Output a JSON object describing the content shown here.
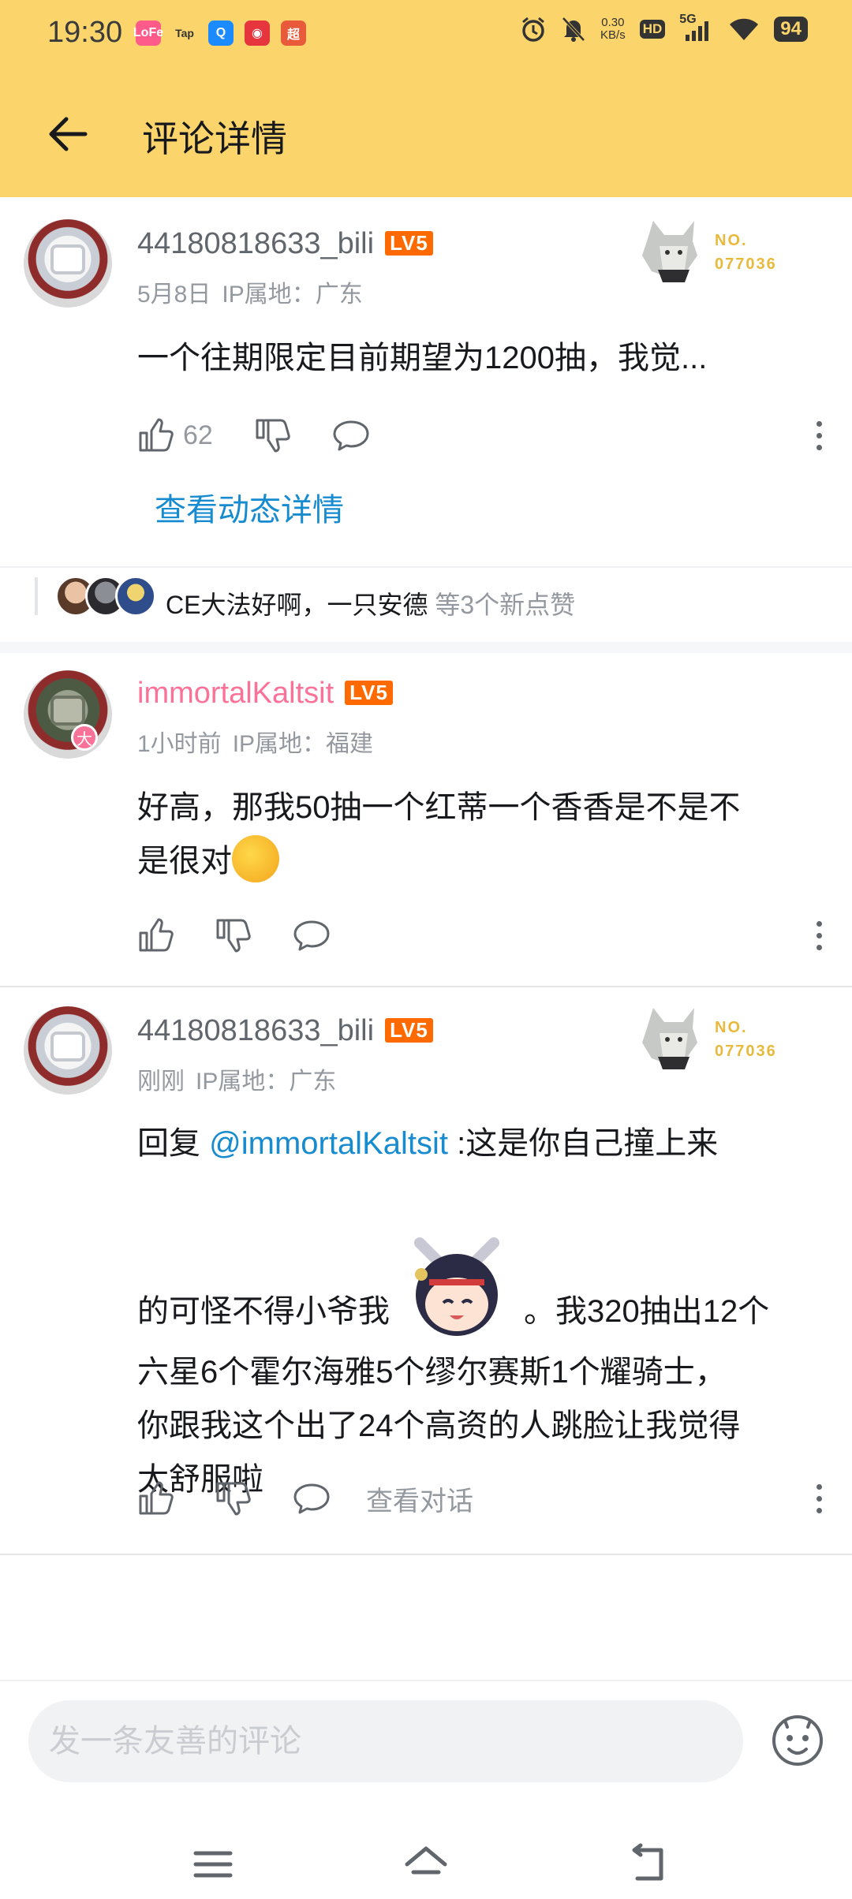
{
  "status_bar": {
    "time": "19:30",
    "net_speed_value": "0.30",
    "net_speed_unit": "KB/s",
    "hd": "HD",
    "signal": "5G",
    "battery": "94",
    "notif_icons": [
      {
        "name": "notif-app-pink-icon",
        "text": "LoFe",
        "color": "#ff5b8a"
      },
      {
        "name": "notif-taptap-icon",
        "text": "Tap",
        "color": "#fbd46c"
      },
      {
        "name": "notif-app-blue-icon",
        "text": "Q",
        "color": "#1b8bff"
      },
      {
        "name": "notif-netease-icon",
        "text": "◉",
        "color": "#e7353d"
      },
      {
        "name": "notif-app-red-icon",
        "text": "超",
        "color": "#e95a3a"
      }
    ]
  },
  "header": {
    "title": "评论详情"
  },
  "comments": [
    {
      "username": "44180818633_bili",
      "level": "LV5",
      "date": "5月8日",
      "ip": "IP属地：广东",
      "content": "一个往期限定目前期望为1200抽，我觉...",
      "likes": "62",
      "fan_no_label": "NO.",
      "fan_no": "077036",
      "detail_link": "查看动态详情"
    },
    {
      "username": "immortalKaltsit",
      "level": "LV5",
      "date": "1小时前",
      "ip": "IP属地：福建",
      "content_line1": "好高，那我50抽一个红蒂一个香香是不是不",
      "content_line2": "是很对",
      "avatar_badge": "大"
    },
    {
      "username": "44180818633_bili",
      "level": "LV5",
      "date": "刚刚",
      "ip": "IP属地：广东",
      "reply_prefix": "回复 ",
      "mention": "@immortalKaltsit",
      "content_line1_rest": " :这是你自己撞上来",
      "content_line2a": "的可怪不得小爷我",
      "content_line2b": "。我320抽出12个",
      "content_line3": "六星6个霍尔海雅5个缪尔赛斯1个耀骑士，",
      "content_line4": "你跟我这个出了24个高资的人跳脸让我觉得",
      "content_line5": "太舒服啦",
      "view_conversation": "查看对话",
      "fan_no_label": "NO.",
      "fan_no": "077036"
    }
  ],
  "like_bar": {
    "names": "CE大法好啊，一只安德",
    "suffix": " 等3个新点赞"
  },
  "bottom": {
    "input_placeholder": "发一条友善的评论"
  },
  "colors": {
    "header_bg": "#fbd46c",
    "pink_username": "#fb7299",
    "link_blue": "#178bcf",
    "level_orange": "#ff6a00"
  }
}
